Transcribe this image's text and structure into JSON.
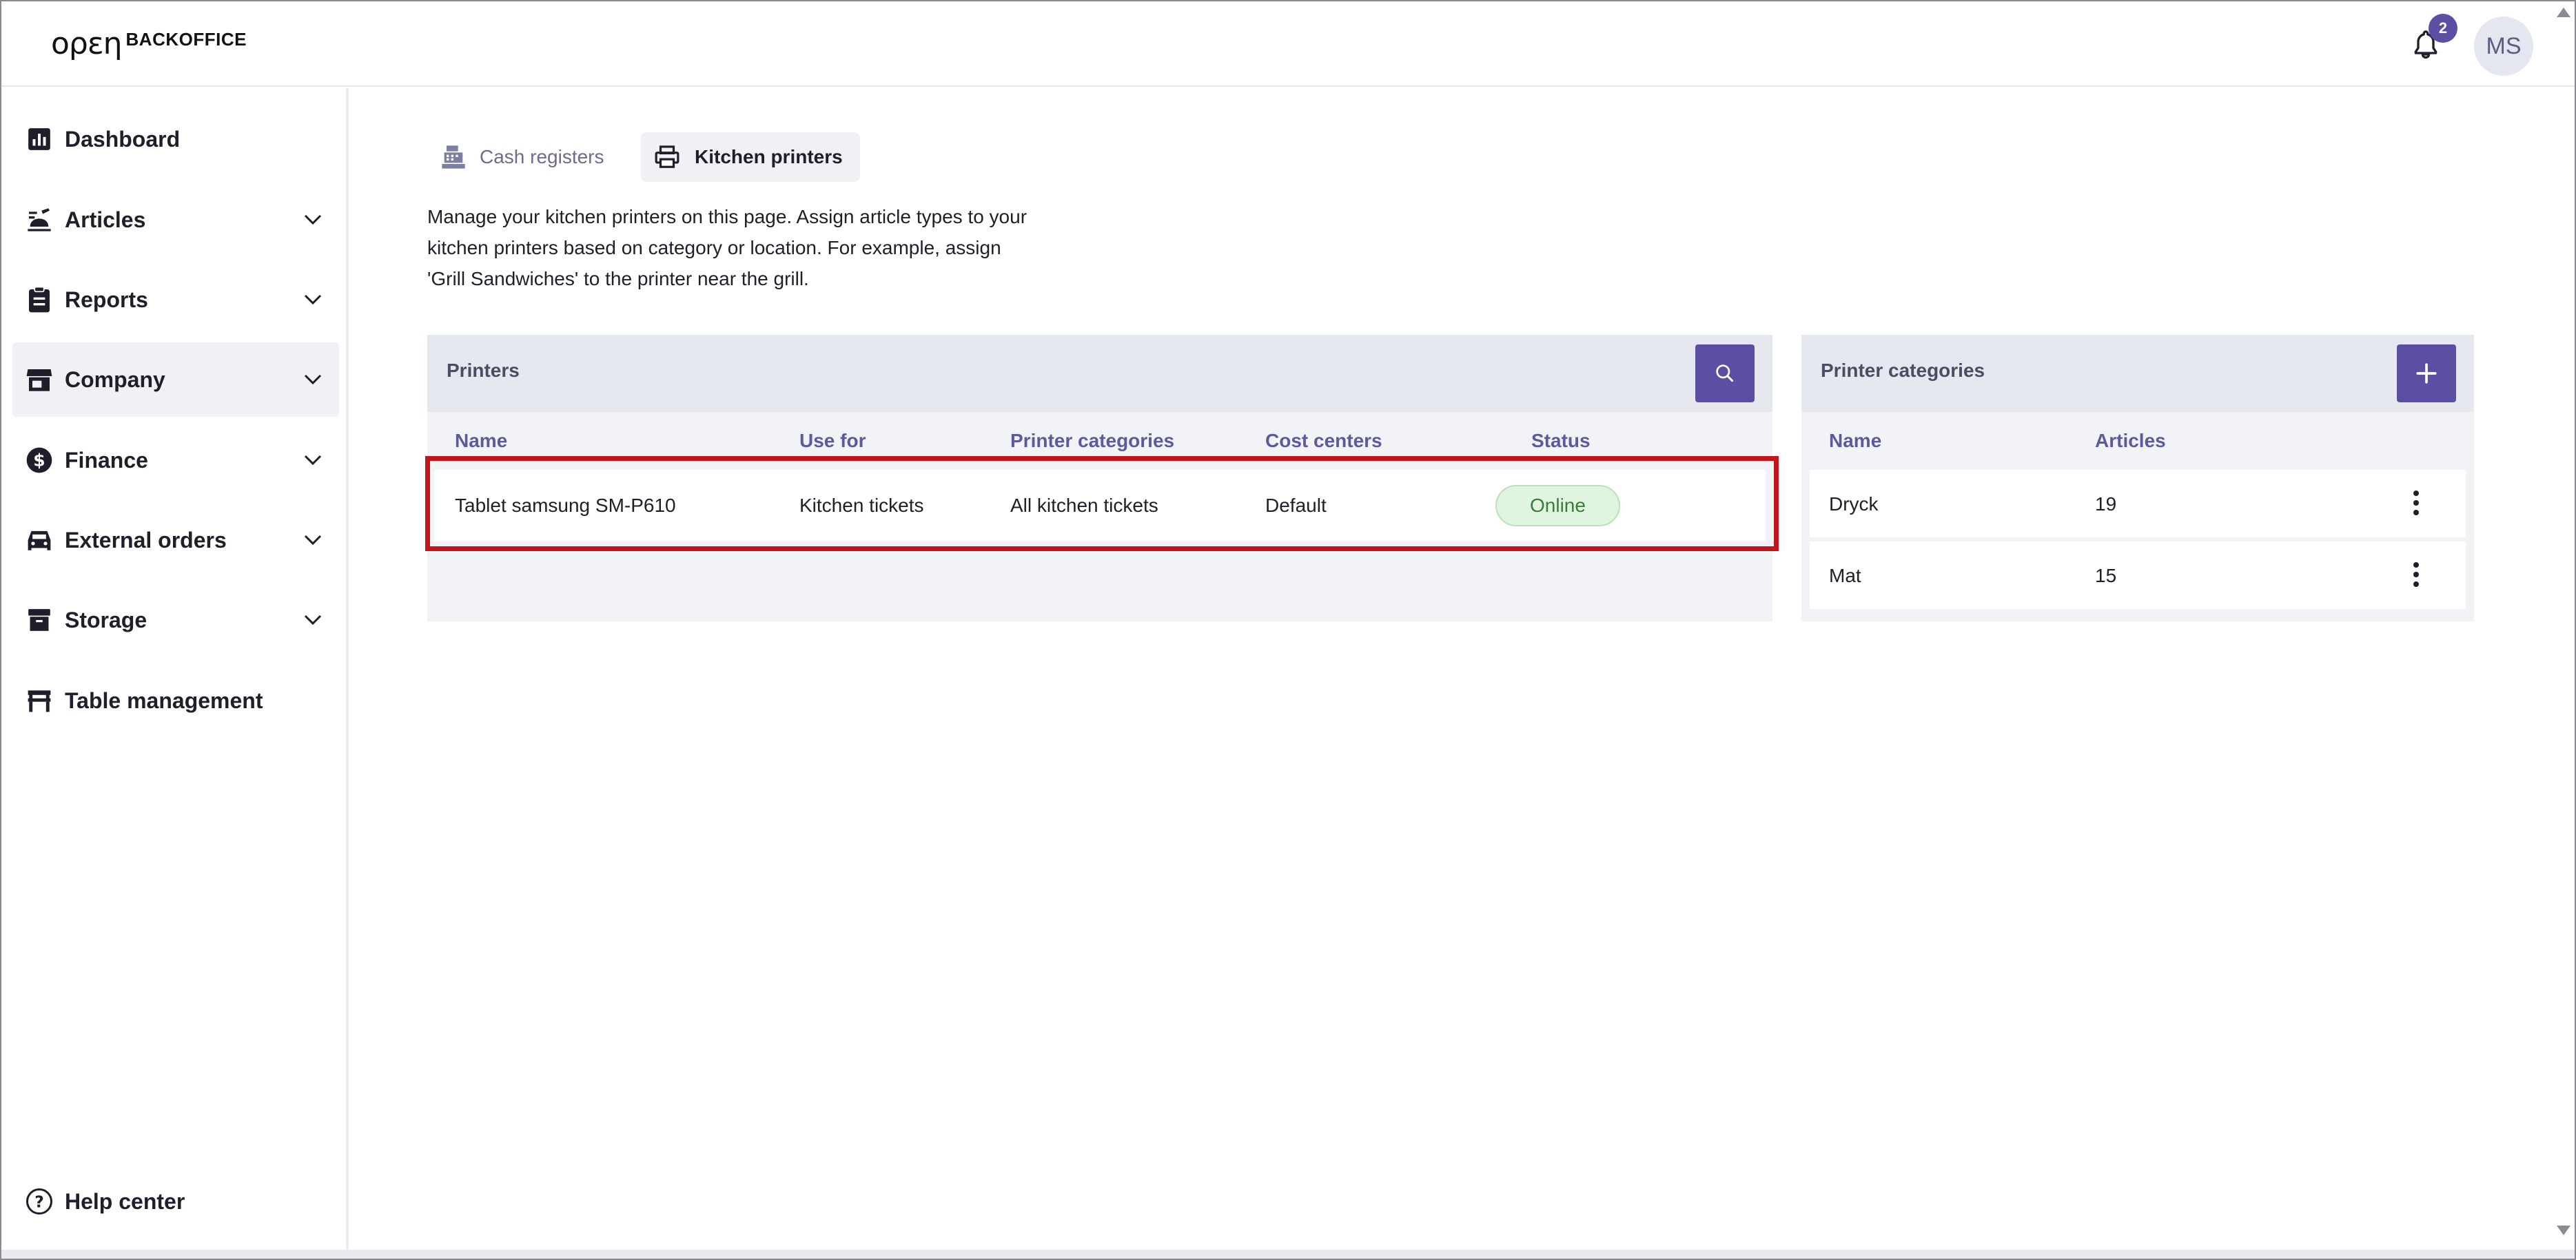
{
  "header": {
    "logo_mark": "oρεη",
    "logo_text": "BACKOFFICE",
    "notification_count": "2",
    "avatar_initials": "MS"
  },
  "sidebar": {
    "items": [
      {
        "label": "Dashboard",
        "icon": "bar-chart-icon",
        "has_chevron": false
      },
      {
        "label": "Articles",
        "icon": "food-icon",
        "has_chevron": true
      },
      {
        "label": "Reports",
        "icon": "clipboard-icon",
        "has_chevron": true
      },
      {
        "label": "Company",
        "icon": "store-icon",
        "has_chevron": true,
        "active": true
      },
      {
        "label": "Finance",
        "icon": "dollar-icon",
        "has_chevron": true
      },
      {
        "label": "External orders",
        "icon": "car-icon",
        "has_chevron": true
      },
      {
        "label": "Storage",
        "icon": "archive-icon",
        "has_chevron": true
      },
      {
        "label": "Table management",
        "icon": "table-icon",
        "has_chevron": false
      }
    ],
    "help": {
      "label": "Help center",
      "icon": "help-circle-icon"
    }
  },
  "tabs": [
    {
      "label": "Cash registers",
      "icon": "cash-register-icon",
      "active": false
    },
    {
      "label": "Kitchen printers",
      "icon": "printer-icon",
      "active": true
    }
  ],
  "description": [
    "Manage your kitchen printers on this page. Assign article types to your",
    "kitchen printers based on category or location. For example, assign",
    "'Grill Sandwiches' to the printer near the grill."
  ],
  "printers": {
    "title": "Printers",
    "columns": [
      "Name",
      "Use for",
      "Printer categories",
      "Cost centers",
      "Status"
    ],
    "rows": [
      {
        "name": "Tablet samsung SM-P610",
        "use_for": "Kitchen tickets",
        "categories": "All kitchen tickets",
        "cost_center": "Default",
        "status": "Online"
      }
    ]
  },
  "printer_categories": {
    "title": "Printer categories",
    "columns": [
      "Name",
      "Articles"
    ],
    "rows": [
      {
        "name": "Dryck",
        "articles": "19"
      },
      {
        "name": "Mat",
        "articles": "15"
      }
    ]
  },
  "colors": {
    "accent": "#5c4fa3",
    "highlight": "#c0161b",
    "status_online_bg": "#dff5df",
    "status_online_text": "#3a7d3a",
    "panel_bg": "#f2f3f7",
    "panel_head_bg": "#e6e8f0"
  }
}
